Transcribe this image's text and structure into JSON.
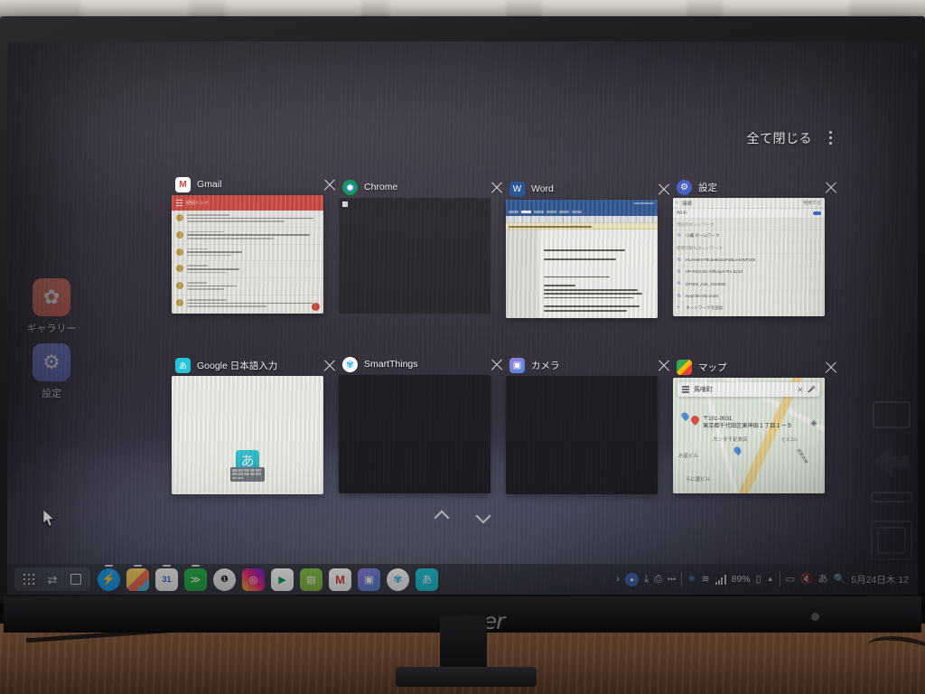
{
  "device": {
    "brand": "acer"
  },
  "overview": {
    "close_all_label": "全て閉じる",
    "menu_icon": "kebab-menu-icon",
    "pager": {
      "up_icon": "chevron-up-icon",
      "down_icon": "chevron-down-icon"
    },
    "cards": [
      {
        "app": "Gmail",
        "icon": "gmail-icon",
        "close_icon": "close-icon",
        "thumb_type": "gmail",
        "thumb": {
          "header_color": "#d7453b",
          "header_label": "受信トレイ",
          "rows": 7
        }
      },
      {
        "app": "Chrome",
        "icon": "chrome-icon",
        "close_icon": "close-icon",
        "thumb_type": "empty",
        "thumb": {
          "note": ""
        }
      },
      {
        "app": "Word",
        "icon": "word-icon",
        "close_icon": "close-icon",
        "thumb_type": "word",
        "thumb": {
          "ribbon_color": "#2b579a",
          "warning_bar_color": "#fdf3cf"
        }
      },
      {
        "app": "設定",
        "icon": "settings-gear-icon",
        "close_icon": "close-icon",
        "thumb_type": "settings",
        "thumb": {
          "title": "接続",
          "right_label": "検索する",
          "toggle_row": "Wi-Fi",
          "section_current": "現在のネットワーク",
          "current_network": "小暮 ホームワーク",
          "current_network_sub": "接続",
          "section_available": "使用可能なネットワーク",
          "networks": [
            "HUAWEI-P8Lite8DuoPoBLe-DWF200",
            "HP-Print-8C-Officejet Pro 8210",
            "DTWN_A35_1024MB",
            "KepObs-5G-2426"
          ],
          "footer": "ネットワークを追加"
        }
      },
      {
        "app": "Google 日本語入力",
        "icon": "google-japanese-input-icon",
        "close_icon": "close-icon",
        "thumb_type": "jinput",
        "thumb": {
          "key_char": "あ"
        }
      },
      {
        "app": "SmartThings",
        "icon": "smartthings-icon",
        "close_icon": "close-icon",
        "thumb_type": "dark",
        "thumb": {}
      },
      {
        "app": "カメラ",
        "icon": "camera-icon",
        "close_icon": "close-icon",
        "thumb_type": "dark",
        "thumb": {}
      },
      {
        "app": "マップ",
        "icon": "google-maps-icon",
        "close_icon": "close-icon",
        "thumb_type": "maps",
        "thumb": {
          "search_query": "馬喰町",
          "search_clear_icon": "close-icon",
          "search_mic_icon": "microphone-icon",
          "menu_icon": "hamburger-icon",
          "layers_icon": "layers-icon",
          "postal_code": "〒101-0031",
          "address": "東京都千代田区東神田１丁目１ー９",
          "poi_labels": [
            "カンダ千足本店",
            "水星ビル",
            "らに屋ビル",
            "ビスコル",
            "総武本線"
          ]
        }
      }
    ]
  },
  "desktop_icons": [
    {
      "label": "ギャラリー",
      "icon": "gallery-icon"
    },
    {
      "label": "設定",
      "icon": "settings-gear-icon"
    }
  ],
  "shelf": {
    "launcher_icon": "app-launcher-grid-icon",
    "back_icon": "back-arrow-icon",
    "overview_icon": "overview-square-icon",
    "apps": [
      {
        "name": "Messenger",
        "icon": "messenger-icon",
        "running": true,
        "color": "#1da1f2",
        "glyph": "⚡"
      },
      {
        "name": "ギャラリー",
        "icon": "gallery-icon",
        "running": true,
        "color": "#f2c14e",
        "glyph": ""
      },
      {
        "name": "カレンダー",
        "icon": "calendar-icon",
        "running": true,
        "color": "#f4f4f4",
        "glyph": "31"
      },
      {
        "name": "Feedly",
        "icon": "feedly-icon",
        "running": true,
        "color": "#2bb24c",
        "glyph": "≫"
      },
      {
        "name": "Authenticator",
        "icon": "key-icon",
        "running": false,
        "color": "#f1f1f1",
        "glyph": "❶"
      },
      {
        "name": "Instagram",
        "icon": "instagram-icon",
        "running": false,
        "color": "#d6249f",
        "glyph": "◎"
      },
      {
        "name": "Play ストア",
        "icon": "play-store-icon",
        "running": false,
        "color": "#ffffff",
        "glyph": "▶"
      },
      {
        "name": "Excel",
        "icon": "spreadsheet-icon",
        "running": false,
        "color": "#8bc34a",
        "glyph": "▤"
      },
      {
        "name": "Gmail",
        "icon": "gmail-icon",
        "running": false,
        "color": "#ffffff",
        "glyph": "M"
      },
      {
        "name": "カメラ",
        "icon": "camera-icon",
        "running": false,
        "color": "#6b8fd6",
        "glyph": "▣"
      },
      {
        "name": "SmartThings",
        "icon": "smartthings-icon",
        "running": false,
        "color": "#ffffff",
        "glyph": "✾"
      },
      {
        "name": "Google 日本語入力",
        "icon": "google-japanese-input-icon",
        "running": false,
        "color": "#26c6da",
        "glyph": "あ"
      }
    ],
    "tray": {
      "expand_icon": "chevron-right-icon",
      "account_icon": "account-avatar-icon",
      "download_icon": "download-icon",
      "print_icon": "printer-icon",
      "more_icon": "more-dots-icon",
      "bluetooth_icon": "bluetooth-icon",
      "wifi_icon": "wifi-icon",
      "signal_icon": "cellular-signal-icon",
      "battery_percent": "89%",
      "battery_icon": "battery-icon",
      "caret_icon": "caret-up-icon",
      "screencast_icon": "screencast-icon",
      "volume_mute_icon": "volume-mute-icon",
      "ime_icon": "ime-japanese-icon",
      "search_icon": "search-icon",
      "clock": "5月24日木 12"
    }
  }
}
